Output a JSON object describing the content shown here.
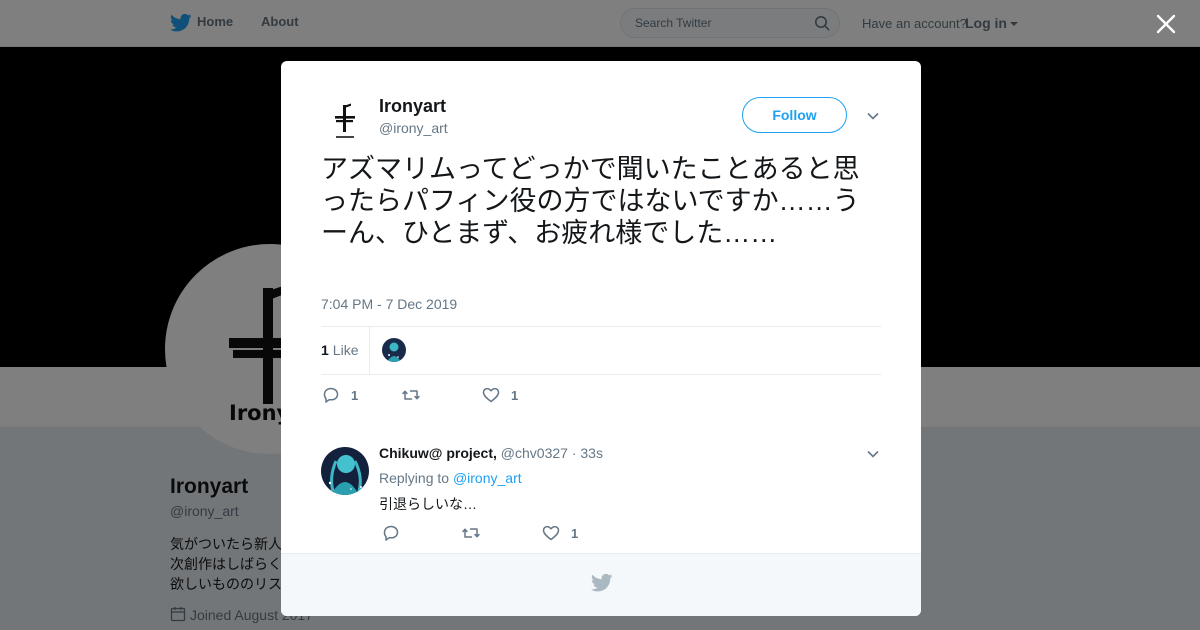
{
  "topnav": {
    "home_label": "Home",
    "about_label": "About",
    "search_placeholder": "Search Twitter",
    "account_prompt": "Have an account?",
    "login_label": "Log in"
  },
  "profile_background": {
    "name": "Ironyart",
    "handle": "@irony_art",
    "bio_lines": [
      "気がついたら新人",
      "次創作はしばらく",
      "欲しいもののリス"
    ],
    "joined": "Joined August 2017",
    "avatar_logo_text": "IronyArt"
  },
  "tweet": {
    "author_name": "Ironyart",
    "author_handle": "@irony_art",
    "follow_label": "Follow",
    "text": "アズマリムってどっかで聞いたことあると思ったらパフィン役の方ではないですか……うーん、ひとまず、お疲れ様でした……",
    "timestamp": "7:04 PM - 7 Dec 2019",
    "likes_count": "1",
    "likes_label": "Like",
    "reply_count": "1",
    "retweet_count": "",
    "like_count": "1"
  },
  "reply": {
    "author_name": "Chikuw@ project,",
    "author_handle": "@chv0327",
    "age": "· 33s",
    "replying_prefix": "Replying to",
    "replying_to": "@irony_art",
    "text": "引退らしいな…",
    "reply_count": "",
    "retweet_count": "",
    "like_count": "1"
  },
  "colors": {
    "brand_blue": "#1da1f2",
    "muted_text": "#657786",
    "banner": "#000000"
  }
}
